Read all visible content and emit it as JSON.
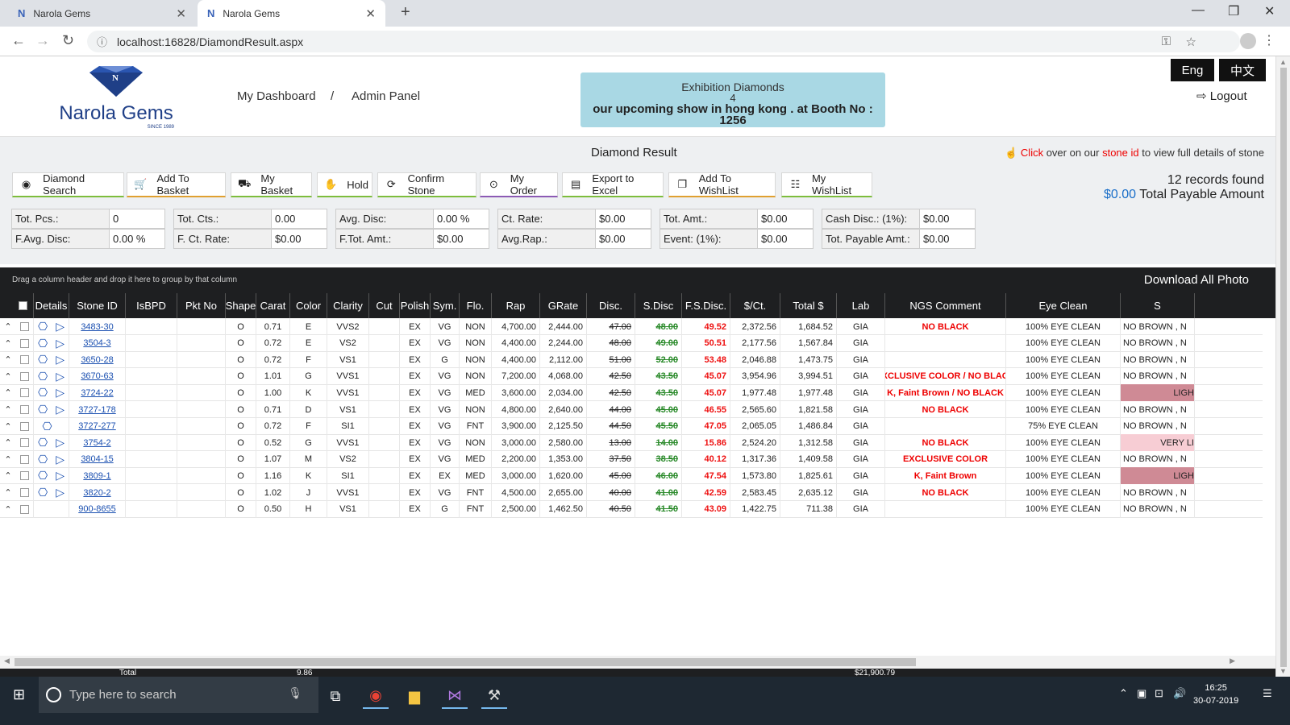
{
  "browser": {
    "tabs": [
      {
        "title": "Narola Gems"
      },
      {
        "title": "Narola Gems"
      }
    ],
    "url": "localhost:16828/DiamondResult.aspx"
  },
  "header": {
    "logo_text": "Narola Gems",
    "logo_since": "SINCE 1989",
    "nav": [
      "My Dashboard",
      "/",
      "Admin Panel"
    ],
    "announce_title": "Exhibition Diamonds",
    "announce_count": "4",
    "announce_text": "our upcoming show in hong kong . at Booth No : 1256",
    "lang_en": "Eng",
    "lang_zh": "中文",
    "logout": "Logout"
  },
  "resultbar": {
    "title": "Diamond Result",
    "hint_click": "Click",
    "hint_mid": " over on our ",
    "hint_stone": "stone id",
    "hint_end": " to view full details of stone"
  },
  "toolbar": [
    {
      "label": "Diamond Search",
      "icon": "search-icon"
    },
    {
      "label": "Add To Basket",
      "icon": "cart-add-icon"
    },
    {
      "label": "My Basket",
      "icon": "basket-icon"
    },
    {
      "label": "Hold",
      "icon": "hand-icon"
    },
    {
      "label": "Confirm Stone",
      "icon": "confirm-icon"
    },
    {
      "label": "My Order",
      "icon": "order-icon"
    },
    {
      "label": "Export to Excel",
      "icon": "excel-icon"
    },
    {
      "label": "Add To WishList",
      "icon": "wishlist-add-icon"
    },
    {
      "label": "My WishList",
      "icon": "wishlist-icon"
    }
  ],
  "records_found": "12 records found",
  "payable_amount": "$0.00",
  "payable_label": " Total Payable Amount",
  "summary": [
    [
      {
        "label": "Tot. Pcs.:",
        "value": "0"
      },
      {
        "label": "Tot. Cts.:",
        "value": "0.00"
      },
      {
        "label": "Avg. Disc:",
        "value": "0.00 %"
      },
      {
        "label": "Ct. Rate:",
        "value": "$0.00"
      },
      {
        "label": "Tot. Amt.:",
        "value": "$0.00"
      },
      {
        "label": "Cash Disc.: (1%):",
        "value": "$0.00"
      }
    ],
    [
      {
        "label": "F.Avg. Disc:",
        "value": "0.00 %"
      },
      {
        "label": "F. Ct. Rate:",
        "value": "$0.00"
      },
      {
        "label": "F.Tot. Amt.:",
        "value": "$0.00"
      },
      {
        "label": "Avg.Rap.:",
        "value": "$0.00"
      },
      {
        "label": "Event: (1%):",
        "value": "$0.00"
      },
      {
        "label": "Tot. Payable Amt.:",
        "value": "$0.00"
      }
    ]
  ],
  "grid": {
    "group_hint": "Drag a column header and drop it here to group by that column",
    "download_all": "Download All Photo",
    "columns": [
      "",
      "Details",
      "Stone ID",
      "IsBPD",
      "Pkt No",
      "Shape",
      "Carat",
      "Color",
      "Clarity",
      "Cut",
      "Polish",
      "Sym.",
      "Flo.",
      "Rap",
      "GRate",
      "Disc.",
      "S.Disc",
      "F.S.Disc.",
      "$/Ct.",
      "Total $",
      "Lab",
      "NGS Comment",
      "Eye Clean",
      "S"
    ],
    "rows": [
      {
        "id": "3483-30",
        "shape": "O",
        "carat": "0.71",
        "color": "E",
        "clarity": "VVS2",
        "polish": "EX",
        "sym": "VG",
        "flo": "NON",
        "rap": "4,700.00",
        "grate": "2,444.00",
        "disc": "47.00",
        "sdisc": "48.00",
        "fsdisc": "49.52",
        "perct": "2,372.56",
        "total": "1,684.52",
        "lab": "GIA",
        "ngs": "NO BLACK",
        "eye": "100% EYE CLEAN",
        "shade": "NO BROWN , N",
        "video": true,
        "photo": true
      },
      {
        "id": "3504-3",
        "shape": "O",
        "carat": "0.72",
        "color": "E",
        "clarity": "VS2",
        "polish": "EX",
        "sym": "VG",
        "flo": "NON",
        "rap": "4,400.00",
        "grate": "2,244.00",
        "disc": "48.00",
        "sdisc": "49.00",
        "fsdisc": "50.51",
        "perct": "2,177.56",
        "total": "1,567.84",
        "lab": "GIA",
        "ngs": "",
        "eye": "100% EYE CLEAN",
        "shade": "NO BROWN , N",
        "video": true,
        "photo": true
      },
      {
        "id": "3650-28",
        "shape": "O",
        "carat": "0.72",
        "color": "F",
        "clarity": "VS1",
        "polish": "EX",
        "sym": "G",
        "flo": "NON",
        "rap": "4,400.00",
        "grate": "2,112.00",
        "disc": "51.00",
        "sdisc": "52.00",
        "fsdisc": "53.48",
        "perct": "2,046.88",
        "total": "1,473.75",
        "lab": "GIA",
        "ngs": "",
        "eye": "100% EYE CLEAN",
        "shade": "NO BROWN , N",
        "video": true,
        "photo": true
      },
      {
        "id": "3670-63",
        "shape": "O",
        "carat": "1.01",
        "color": "G",
        "clarity": "VVS1",
        "polish": "EX",
        "sym": "VG",
        "flo": "NON",
        "rap": "7,200.00",
        "grate": "4,068.00",
        "disc": "42.50",
        "sdisc": "43.50",
        "fsdisc": "45.07",
        "perct": "3,954.96",
        "total": "3,994.51",
        "lab": "GIA",
        "ngs": "EXCLUSIVE COLOR / NO BLACK",
        "eye": "100% EYE CLEAN",
        "shade": "NO BROWN , N",
        "video": true,
        "photo": true
      },
      {
        "id": "3724-22",
        "shape": "O",
        "carat": "1.00",
        "color": "K",
        "clarity": "VVS1",
        "polish": "EX",
        "sym": "VG",
        "flo": "MED",
        "rap": "3,600.00",
        "grate": "2,034.00",
        "disc": "42.50",
        "sdisc": "43.50",
        "fsdisc": "45.07",
        "perct": "1,977.48",
        "total": "1,977.48",
        "lab": "GIA",
        "ngs": "K, Faint Brown / NO BLACK",
        "eye": "100% EYE CLEAN",
        "shade": "LIGH",
        "video": true,
        "photo": true,
        "shadebg": "#cf8a95"
      },
      {
        "id": "3727-178",
        "shape": "O",
        "carat": "0.71",
        "color": "D",
        "clarity": "VS1",
        "polish": "EX",
        "sym": "VG",
        "flo": "NON",
        "rap": "4,800.00",
        "grate": "2,640.00",
        "disc": "44.00",
        "sdisc": "45.00",
        "fsdisc": "46.55",
        "perct": "2,565.60",
        "total": "1,821.58",
        "lab": "GIA",
        "ngs": "NO BLACK",
        "eye": "100% EYE CLEAN",
        "shade": "NO BROWN , N",
        "video": true,
        "photo": true
      },
      {
        "id": "3727-277",
        "shape": "O",
        "carat": "0.72",
        "color": "F",
        "clarity": "SI1",
        "polish": "EX",
        "sym": "VG",
        "flo": "FNT",
        "rap": "3,900.00",
        "grate": "2,125.50",
        "disc": "44.50",
        "sdisc": "45.50",
        "fsdisc": "47.05",
        "perct": "2,065.05",
        "total": "1,486.84",
        "lab": "GIA",
        "ngs": "",
        "eye": "75% EYE CLEAN",
        "shade": "NO BROWN , N",
        "video": false,
        "photo": true
      },
      {
        "id": "3754-2",
        "shape": "O",
        "carat": "0.52",
        "color": "G",
        "clarity": "VVS1",
        "polish": "EX",
        "sym": "VG",
        "flo": "NON",
        "rap": "3,000.00",
        "grate": "2,580.00",
        "disc": "13.00",
        "sdisc": "14.00",
        "fsdisc": "15.86",
        "perct": "2,524.20",
        "total": "1,312.58",
        "lab": "GIA",
        "ngs": "NO BLACK",
        "eye": "100% EYE CLEAN",
        "shade": "VERY LI",
        "video": true,
        "photo": true,
        "shadebg": "#f7cdd4"
      },
      {
        "id": "3804-15",
        "shape": "O",
        "carat": "1.07",
        "color": "M",
        "clarity": "VS2",
        "polish": "EX",
        "sym": "VG",
        "flo": "MED",
        "rap": "2,200.00",
        "grate": "1,353.00",
        "disc": "37.50",
        "sdisc": "38.50",
        "fsdisc": "40.12",
        "perct": "1,317.36",
        "total": "1,409.58",
        "lab": "GIA",
        "ngs": "EXCLUSIVE COLOR",
        "eye": "100% EYE CLEAN",
        "shade": "NO BROWN , N",
        "video": true,
        "photo": true
      },
      {
        "id": "3809-1",
        "shape": "O",
        "carat": "1.16",
        "color": "K",
        "clarity": "SI1",
        "polish": "EX",
        "sym": "EX",
        "flo": "MED",
        "rap": "3,000.00",
        "grate": "1,620.00",
        "disc": "45.00",
        "sdisc": "46.00",
        "fsdisc": "47.54",
        "perct": "1,573.80",
        "total": "1,825.61",
        "lab": "GIA",
        "ngs": "K, Faint Brown",
        "eye": "100% EYE CLEAN",
        "shade": "LIGH",
        "video": true,
        "photo": true,
        "shadebg": "#cf8a95"
      },
      {
        "id": "3820-2",
        "shape": "O",
        "carat": "1.02",
        "color": "J",
        "clarity": "VVS1",
        "polish": "EX",
        "sym": "VG",
        "flo": "FNT",
        "rap": "4,500.00",
        "grate": "2,655.00",
        "disc": "40.00",
        "sdisc": "41.00",
        "fsdisc": "42.59",
        "perct": "2,583.45",
        "total": "2,635.12",
        "lab": "GIA",
        "ngs": "NO BLACK",
        "eye": "100% EYE CLEAN",
        "shade": "NO BROWN , N",
        "video": true,
        "photo": true
      },
      {
        "id": "900-8655",
        "shape": "O",
        "carat": "0.50",
        "color": "H",
        "clarity": "VS1",
        "polish": "EX",
        "sym": "G",
        "flo": "FNT",
        "rap": "2,500.00",
        "grate": "1,462.50",
        "disc": "40.50",
        "sdisc": "41.50",
        "fsdisc": "43.09",
        "perct": "1,422.75",
        "total": "711.38",
        "lab": "GIA",
        "ngs": "",
        "eye": "100% EYE CLEAN",
        "shade": "NO BROWN , N",
        "video": false,
        "photo": false
      }
    ],
    "footer": {
      "label": "Total",
      "carat": "9.86",
      "total": "$21,900.79"
    }
  },
  "taskbar": {
    "search_placeholder": "Type here to search",
    "time": "16:25",
    "date": "30-07-2019"
  }
}
